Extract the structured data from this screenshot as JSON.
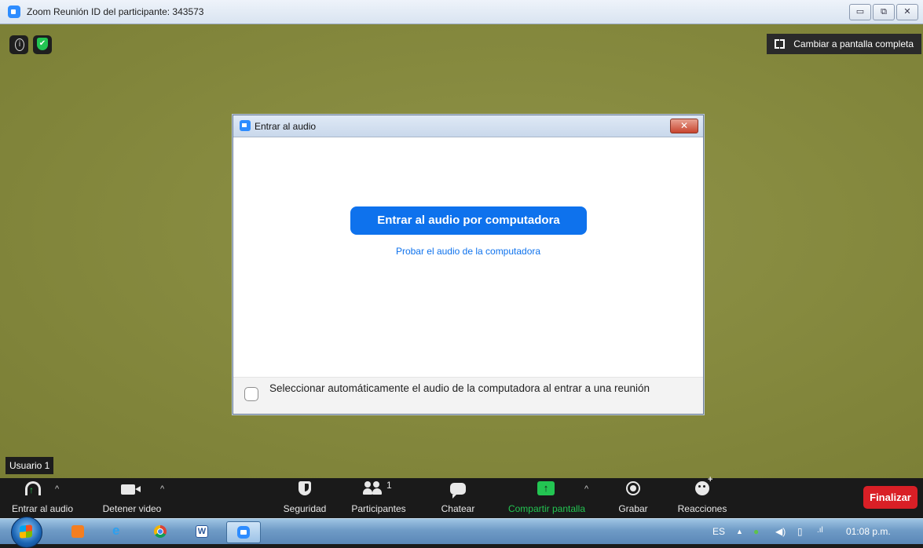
{
  "window": {
    "title": "Zoom Reunión ID del participante: 343573",
    "controls": [
      "minimize",
      "restore",
      "close"
    ]
  },
  "video": {
    "fullscreen_label": "Cambiar a pantalla completa",
    "participant_name": "Usuario 1",
    "background_color": "#868a3f"
  },
  "dialog": {
    "title": "Entrar al audio",
    "primary_button": "Entrar al audio por computadora",
    "test_link": "Probar el audio de la computadora",
    "auto_select_label": "Seleccionar automáticamente el audio de la computadora al entrar a una reunión",
    "auto_select_checked": false
  },
  "toolbar": {
    "audio_label": "Entrar al audio",
    "video_label": "Detener video",
    "security_label": "Seguridad",
    "participants_label": "Participantes",
    "participants_count": "1",
    "chat_label": "Chatear",
    "share_label": "Compartir pantalla",
    "record_label": "Grabar",
    "reactions_label": "Reacciones",
    "end_label": "Finalizar",
    "caret": "^"
  },
  "taskbar": {
    "apps": [
      "media-player",
      "internet-explorer",
      "chrome",
      "word",
      "zoom"
    ],
    "language": "ES",
    "time": "01:08 p.m.",
    "accent": "#0e72ed",
    "end_color": "#d91f26",
    "share_color": "#23c552"
  }
}
